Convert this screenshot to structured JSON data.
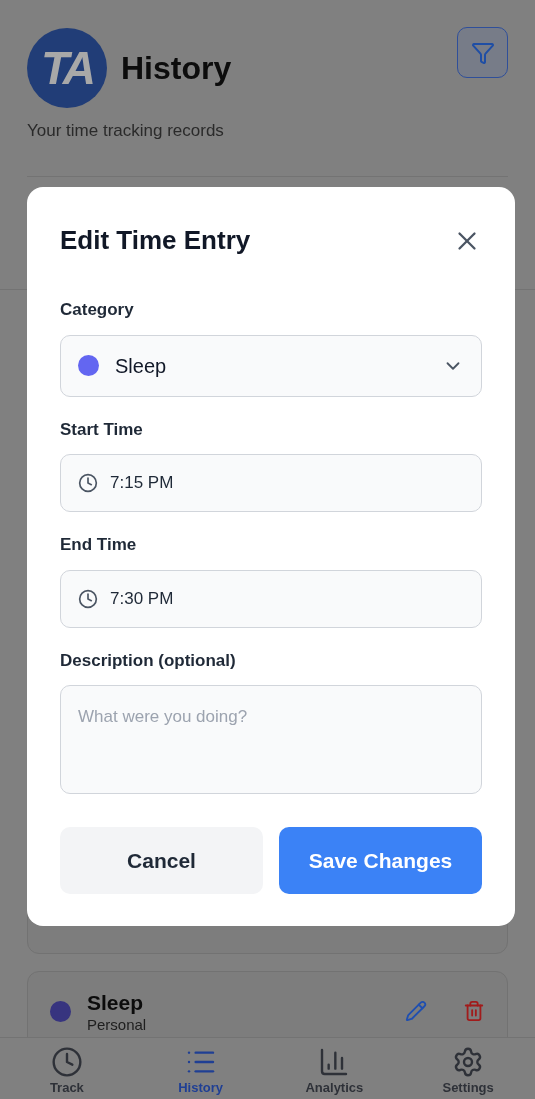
{
  "header": {
    "logo_text": "TA",
    "title": "History",
    "subtitle": "Your time tracking records"
  },
  "entries": [
    {
      "category": "Sleep",
      "subcategory": "Personal",
      "color": "#37347f"
    }
  ],
  "nav": [
    {
      "label": "Track",
      "kind": "clock",
      "selected": false
    },
    {
      "label": "History",
      "kind": "list",
      "selected": true
    },
    {
      "label": "Analytics",
      "kind": "chart",
      "selected": false
    },
    {
      "label": "Settings",
      "kind": "gear",
      "selected": false
    }
  ],
  "modal": {
    "title": "Edit Time Entry",
    "category": {
      "label": "Category",
      "value": "Sleep",
      "color": "#6366f1"
    },
    "start": {
      "label": "Start Time",
      "value": "7:15 PM"
    },
    "end": {
      "label": "End Time",
      "value": "7:30 PM"
    },
    "description": {
      "label": "Description (optional)",
      "placeholder": "What were you doing?"
    },
    "buttons": [
      {
        "label": "Cancel",
        "kind": "secondary"
      },
      {
        "label": "Save Changes",
        "kind": "primary"
      }
    ]
  }
}
